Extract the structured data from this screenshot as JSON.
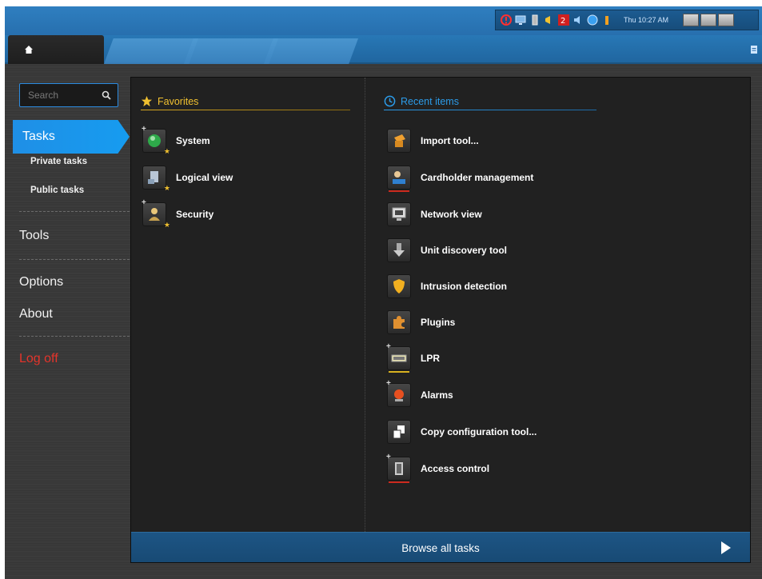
{
  "colors": {
    "accent_blue": "#169cf0",
    "favorites_gold": "#f0c030",
    "recent_blue": "#2c9be8",
    "logoff_red": "#e4342b",
    "panel_bg": "#212121",
    "browse_bar": "#1d5585"
  },
  "tray": {
    "clock": "Thu 10:27 AM",
    "icons": [
      "alert-icon",
      "monitor-icon",
      "battery-icon",
      "megaphone-icon",
      "network-alert-icon",
      "volume-icon",
      "globe-icon",
      "signal-icon"
    ]
  },
  "tabs": {
    "home_icon": "home-icon",
    "right_icon": "document-icon"
  },
  "sidebar": {
    "search": {
      "placeholder": "Search",
      "value": ""
    },
    "tasks_label": "Tasks",
    "private_tasks": "Private tasks",
    "public_tasks": "Public tasks",
    "tools": "Tools",
    "options": "Options",
    "about": "About",
    "logoff": "Log off"
  },
  "favorites": {
    "title": "Favorites",
    "items": [
      {
        "label": "System",
        "icon": "globe-icon"
      },
      {
        "label": "Logical view",
        "icon": "logical-tree-icon"
      },
      {
        "label": "Security",
        "icon": "security-user-icon"
      }
    ]
  },
  "recent": {
    "title": "Recent items",
    "items": [
      {
        "label": "Import tool...",
        "icon": "import-box-icon"
      },
      {
        "label": "Cardholder management",
        "icon": "cardholder-icon"
      },
      {
        "label": "Network view",
        "icon": "network-monitor-icon"
      },
      {
        "label": "Unit discovery tool",
        "icon": "download-arrow-icon"
      },
      {
        "label": "Intrusion detection",
        "icon": "shield-icon"
      },
      {
        "label": "Plugins",
        "icon": "puzzle-icon"
      },
      {
        "label": "LPR",
        "icon": "license-plate-icon"
      },
      {
        "label": "Alarms",
        "icon": "alarm-light-icon"
      },
      {
        "label": "Copy configuration tool...",
        "icon": "copy-icon"
      },
      {
        "label": "Access control",
        "icon": "door-icon"
      }
    ]
  },
  "browse": {
    "label": "Browse all tasks"
  }
}
